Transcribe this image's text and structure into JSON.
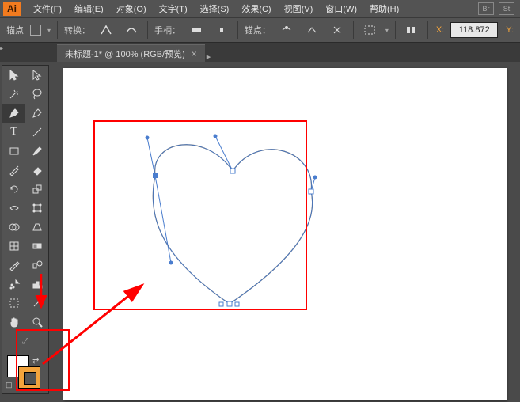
{
  "app_logo": "Ai",
  "menu": {
    "file": "文件(F)",
    "edit": "编辑(E)",
    "object": "对象(O)",
    "type": "文字(T)",
    "select": "选择(S)",
    "effect": "效果(C)",
    "view": "视图(V)",
    "window": "窗口(W)",
    "help": "帮助(H)"
  },
  "menu_right": {
    "br": "Br",
    "st": "St"
  },
  "control": {
    "anchor_label": "锚点",
    "convert_label": "转换：",
    "handles_label": "手柄：",
    "anchors_label": "锚点：",
    "x_label": "X:",
    "x_value": "118.872",
    "y_label": "Y:"
  },
  "tab": {
    "title": "未标题-1* @ 100% (RGB/预览)",
    "close": "×"
  },
  "tools": {
    "selection": "selection-tool",
    "direct": "direct-selection-tool",
    "wand": "magic-wand-tool",
    "lasso": "lasso-tool",
    "pen": "pen-tool",
    "curvature": "curvature-tool",
    "type": "type-tool",
    "line": "line-tool",
    "rect": "rectangle-tool",
    "brush": "paintbrush-tool",
    "pencil": "pencil-tool",
    "eraser": "eraser-tool",
    "rotate": "rotate-tool",
    "scale": "scale-tool",
    "width": "width-tool",
    "free": "free-transform-tool",
    "shape_builder": "shape-builder-tool",
    "perspective": "perspective-tool",
    "mesh": "mesh-tool",
    "gradient": "gradient-tool",
    "eyedropper": "eyedropper-tool",
    "blend": "blend-tool",
    "symbol": "symbol-sprayer-tool",
    "graph": "column-graph-tool",
    "artboard": "artboard-tool",
    "slice": "slice-tool",
    "hand": "hand-tool",
    "zoom": "zoom-tool"
  },
  "colors": {
    "accent": "#f2a33c",
    "annotation": "#f00",
    "path": "#4a7dce"
  }
}
